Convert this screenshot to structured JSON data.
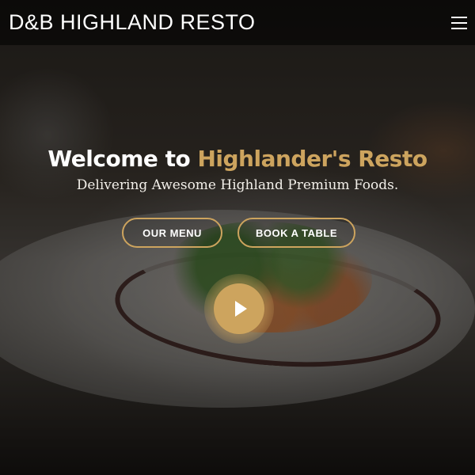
{
  "header": {
    "brand": "D&B HIGHLAND RESTO",
    "menu_icon": "hamburger-menu-icon"
  },
  "hero": {
    "welcome_prefix": "Welcome to ",
    "welcome_highlight": "Highlander's Resto",
    "tagline": "Delivering Awesome Highland Premium Foods.",
    "buttons": {
      "menu_label": "OUR MENU",
      "book_label": "BOOK A TABLE"
    },
    "play_icon": "play-icon"
  },
  "colors": {
    "accent": "#cda45e",
    "text": "#ffffff",
    "header_bg": "rgba(0,0,0,0.55)"
  }
}
